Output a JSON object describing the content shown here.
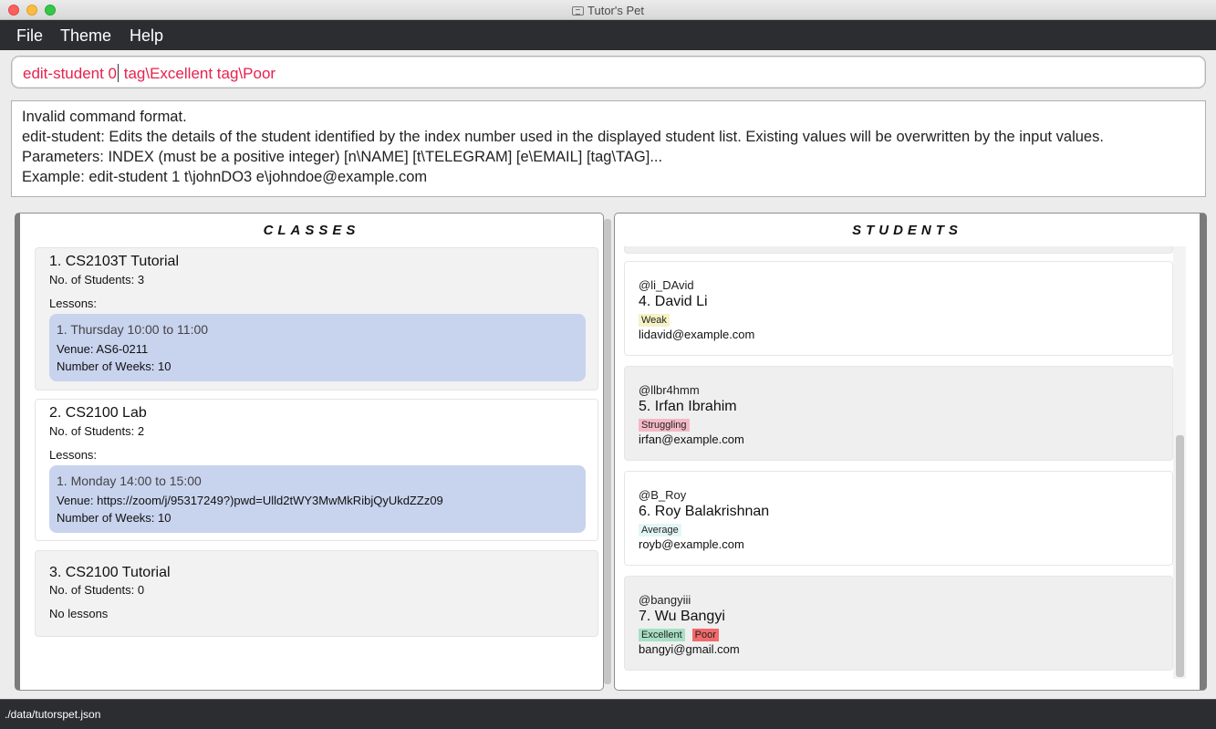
{
  "window": {
    "title": "Tutor's Pet",
    "icons": [
      "close-traffic-light",
      "minimize-traffic-light",
      "zoom-traffic-light",
      "app-icon"
    ]
  },
  "menu": {
    "file": "File",
    "theme": "Theme",
    "help": "Help"
  },
  "command": {
    "before_caret": "edit-student 0",
    "after_caret": " tag\\Excellent tag\\Poor",
    "color": "#e8214c"
  },
  "result": {
    "lines": [
      "Invalid command format.",
      "edit-student: Edits the details of the student identified by the index number used in the displayed student list. Existing values will be overwritten by the input values.",
      "Parameters: INDEX (must be a positive integer) [n\\NAME] [t\\TELEGRAM] [e\\EMAIL] [tag\\TAG]...",
      "Example: edit-student 1 t\\johnDO3 e\\johndoe@example.com"
    ]
  },
  "classes": {
    "title": "CLASSES",
    "items": [
      {
        "name": "1.  CS2103T Tutorial",
        "count": "No. of Students:  3",
        "lessons_label": "Lessons:",
        "lesson": {
          "time": "1. Thursday 10:00 to 11:00",
          "venue": "Venue: AS6-0211",
          "weeks": "Number of Weeks: 10"
        }
      },
      {
        "name": "2.  CS2100 Lab",
        "count": "No. of Students:  2",
        "lessons_label": "Lessons:",
        "lesson": {
          "time": "1. Monday 14:00 to 15:00",
          "venue": "Venue: https://zoom/j/95317249?)pwd=Ulld2tWY3MwMkRibjQyUkdZZz09",
          "weeks": "Number of Weeks: 10"
        }
      },
      {
        "name": "3.  CS2100 Tutorial",
        "count": "No. of Students:  0",
        "lessons_label": "No lessons"
      }
    ]
  },
  "students": {
    "title": "STUDENTS",
    "items": [
      {
        "telegram": "@li_DAvid",
        "name": "4.  David Li",
        "tags": [
          "Weak"
        ],
        "email": "lidavid@example.com"
      },
      {
        "telegram": "@llbr4hmm",
        "name": "5.  Irfan Ibrahim",
        "tags": [
          "Struggling"
        ],
        "email": "irfan@example.com"
      },
      {
        "telegram": "@B_Roy",
        "name": "6.  Roy Balakrishnan",
        "tags": [
          "Average"
        ],
        "email": "royb@example.com"
      },
      {
        "telegram": "@bangyiii",
        "name": "7.  Wu Bangyi",
        "tags": [
          "Excellent",
          "Poor"
        ],
        "email": "bangyi@gmail.com"
      }
    ]
  },
  "status": {
    "path": "./data/tutorspet.json"
  }
}
